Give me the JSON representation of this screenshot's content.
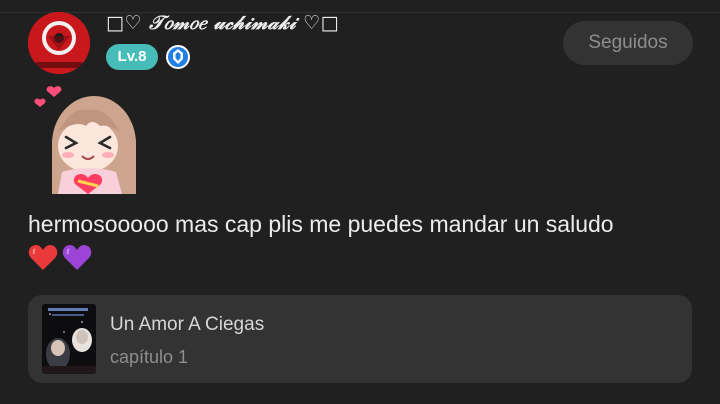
{
  "comment": {
    "author": {
      "display_name": "□♡ 𝒯𝑜𝓂𝑜𝑒 𝓊𝒸𝒽𝒾𝓂𝒶𝓀𝒾 ♡□",
      "level_badge": "Lv.8",
      "verified_badge_icon": "blue-shield-badge-icon",
      "avatar_icon": "red-emblem-avatar"
    },
    "follow_button_label": "Seguidos",
    "sticker_icon": "anime-girl-hearts-sticker",
    "text": "hermosooooo mas cap plis me puedes mandar un saludo",
    "emojis": [
      "red-heart-emoji",
      "purple-heart-emoji"
    ],
    "story_card": {
      "title": "Un Amor A Ciegas",
      "chapter": "capítulo 1",
      "cover_icon": "story-cover-thumbnail"
    }
  },
  "colors": {
    "background": "#202020",
    "card": "#333333",
    "level_badge": "#46bdb8",
    "follow_button_text": "#8d8d8d"
  }
}
